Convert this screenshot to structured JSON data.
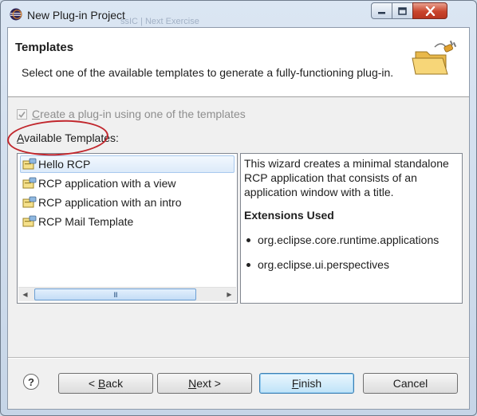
{
  "window": {
    "title": "New Plug-in Project",
    "background_ghost_text": "ssIC | Next Exercise"
  },
  "header": {
    "title": "Templates",
    "description": "Select one of the available templates to generate a fully-functioning plug-in."
  },
  "use_template_checkbox": {
    "label_mnemonic": "C",
    "label_rest": "reate a plug-in using one of the templates",
    "checked": true,
    "enabled": false
  },
  "available_templates": {
    "label_mnemonic": "A",
    "label_rest": "vailable Templates:",
    "items": [
      {
        "label": "Hello RCP",
        "selected": true
      },
      {
        "label": "RCP application with a view"
      },
      {
        "label": "RCP application with an intro"
      },
      {
        "label": "RCP Mail Template"
      }
    ],
    "scroll_grip": "III"
  },
  "description_pane": {
    "text": "This wizard creates a minimal standalone RCP application that consists of an application window with a title.",
    "extensions_heading": "Extensions Used",
    "extensions": [
      "org.eclipse.core.runtime.applications",
      "org.eclipse.ui.perspectives"
    ]
  },
  "buttons": {
    "help": "?",
    "back_prefix": "< ",
    "back_mnemonic": "B",
    "back_rest": "ack",
    "next_mnemonic": "N",
    "next_rest": "ext >",
    "finish_mnemonic": "F",
    "finish_rest": "inish",
    "cancel": "Cancel"
  },
  "colors": {
    "annotation": "#c1272d",
    "selection": "#dceaf9",
    "finish_default": "#3c7fb1"
  },
  "icons": {
    "app": "eclipse-icon",
    "header": "folder-plug-icon",
    "template_item": "plugin-template-icon"
  }
}
